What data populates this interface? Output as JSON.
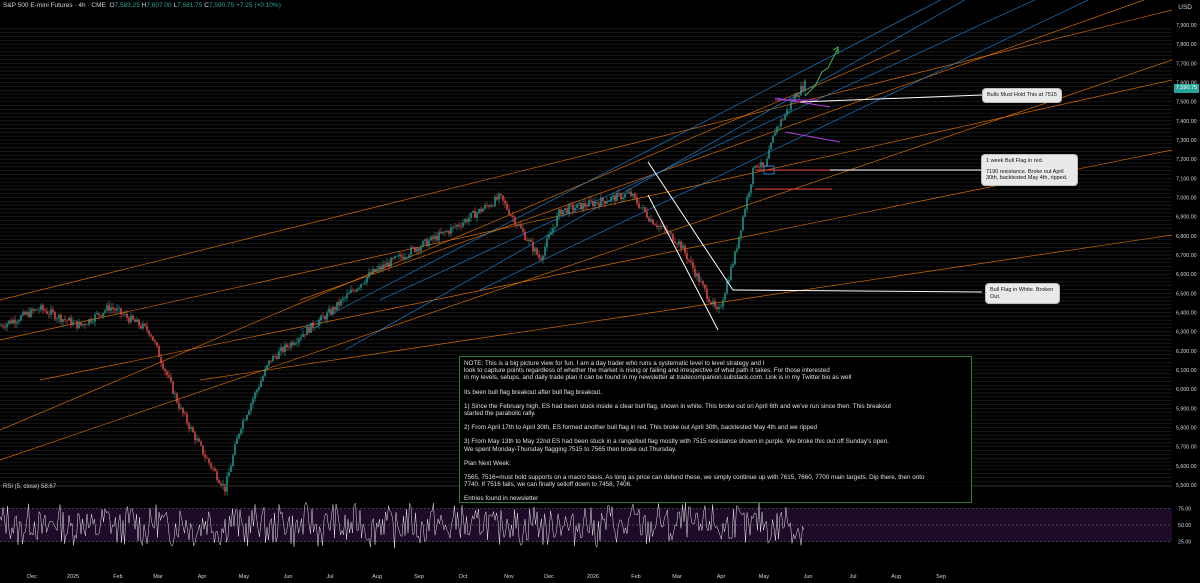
{
  "header": {
    "symbol": "S&P 500 E-mini Futures · 4h · CME",
    "open_label": "O",
    "open": "7,583.25",
    "high_label": "H",
    "high": "7,607.00",
    "low_label": "L",
    "low": "7,581.75",
    "close_label": "C",
    "close": "7,590.75",
    "change": "+7.25 (+0.10%)"
  },
  "currency": "USD",
  "last_price_badge": "7,590.75",
  "price_axis": [
    "7,900.00",
    "7,800.00",
    "7,700.00",
    "7,600.00",
    "7,500.00",
    "7,400.00",
    "7,300.00",
    "7,200.00",
    "7,100.00",
    "7,000.00",
    "6,900.00",
    "6,800.00",
    "6,700.00",
    "6,600.00",
    "6,500.00",
    "6,400.00",
    "6,300.00",
    "6,200.00",
    "6,100.00",
    "6,000.00",
    "5,900.00",
    "5,800.00",
    "5,700.00",
    "5,600.00",
    "5,500.00"
  ],
  "time_axis": [
    "Dec",
    "2025",
    "Feb",
    "Mar",
    "Apr",
    "May",
    "Jun",
    "Jul",
    "Aug",
    "Sep",
    "Oct",
    "Nov",
    "Dec",
    "2026",
    "Feb",
    "Mar",
    "Apr",
    "May",
    "Jun",
    "Jul",
    "Aug",
    "Sep"
  ],
  "rsi": {
    "label": "RSI (5, close)  58.67",
    "levels": [
      "75.00",
      "50.00",
      "25.00"
    ]
  },
  "callouts": {
    "bulls": "Bulls Must Hold This at 7515",
    "red_title": "1 week Bull Flag in red.",
    "red_body": "7190 resistance. Broke out April 30th, backtested May 4th, ripped.",
    "white": "Bull Flag in White. Broken Out."
  },
  "note": {
    "p1": "NOTE: This is a big picture view for fun. I am a day trader who runs a systematic level to level strategy and I\nlook to capture points regardless of whether the market is rising or failing and irrespective of what path it takes. For those interested\nin my levels, setups, and daily trade plan it can be found in my newsletter at tradecompanion.substack.com. Link is in my Twitter bio as well",
    "p2": "Its been bull flag breakout after bull flag breakout.",
    "p3": "1) Since the February high, ES had been stuck inside a clear bull flag, shown in white. This broke out on April 6th and we've run since then. This breakout\nstarted the parabolic rally.",
    "p4": "2) From April 17th to April 30th, ES formed another bull flag in red. This broke out April 30th, backtested May 4th and we ripped",
    "p5": "3) From May 13th to May 22nd ES had been stuck in a range/bull flag mostly with 7515 resistance shown in purple. We broke this out off Sunday's open.\nWe spent Monday-Thursday flagging 7515 to 7565 then broke out Thursday.",
    "p6": "Plan Next Week:",
    "p7": "7565, 7516=must hold supports on a macro basis. As long as price can defend these, we simply continue up with 7615, 7660, 7700 main targets. Dip there, then onto\n7740. If 7516 fails, we can finally selloff down to 7458, 7406.",
    "p8": "Entries found in newsletter"
  },
  "colors": {
    "up": "#26a69a",
    "down": "#ef5350",
    "orange": "#f57c00",
    "blue": "#2196f3",
    "red": "#e53935",
    "purple": "#b040e0",
    "green": "#4caf50"
  }
}
